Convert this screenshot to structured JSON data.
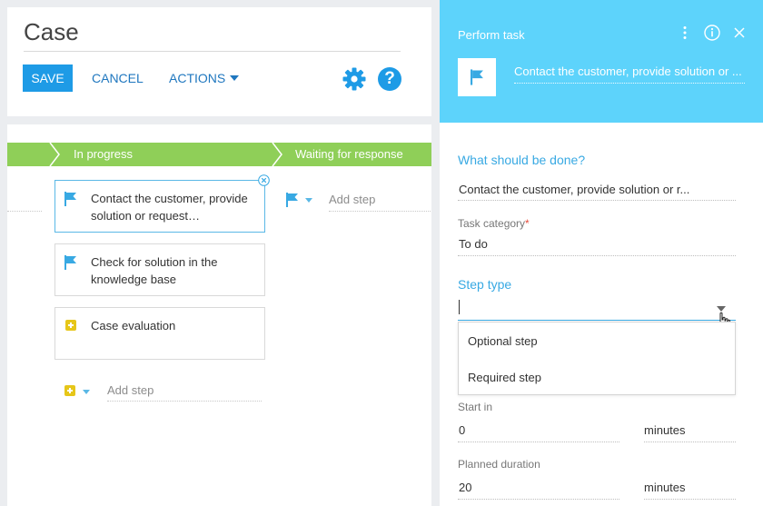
{
  "header": {
    "title": "Case",
    "save_label": "SAVE",
    "cancel_label": "CANCEL",
    "actions_label": "ACTIONS"
  },
  "stages": {
    "current": "In progress",
    "next": "Waiting for response"
  },
  "steps": [
    {
      "label": "Contact the customer, provide solution or request…",
      "icon": "flag-icon"
    },
    {
      "label": "Check for solution in the knowledge base",
      "icon": "flag-icon"
    },
    {
      "label": "Case evaluation",
      "icon": "plus-icon"
    }
  ],
  "add_step_label": "Add step",
  "panel": {
    "heading": "Perform task",
    "task_name": "Contact the customer, provide solution or ...",
    "what_section": "What should be done?",
    "what_value": "Contact the customer, provide solution or r...",
    "category_label": "Task category",
    "category_required_mark": "*",
    "category_value": "To do",
    "steptype_section": "Step type",
    "steptype_options": [
      "Optional step",
      "Required step"
    ],
    "start_in_label": "Start in",
    "start_in_value": "0",
    "start_in_unit": "minutes",
    "duration_label": "Planned duration",
    "duration_value": "20",
    "duration_unit": "minutes"
  },
  "colors": {
    "accent": "#1e9be6",
    "stage_green": "#8fcf58",
    "panel_header": "#5dd3fb",
    "section_blue": "#38a9e3"
  }
}
